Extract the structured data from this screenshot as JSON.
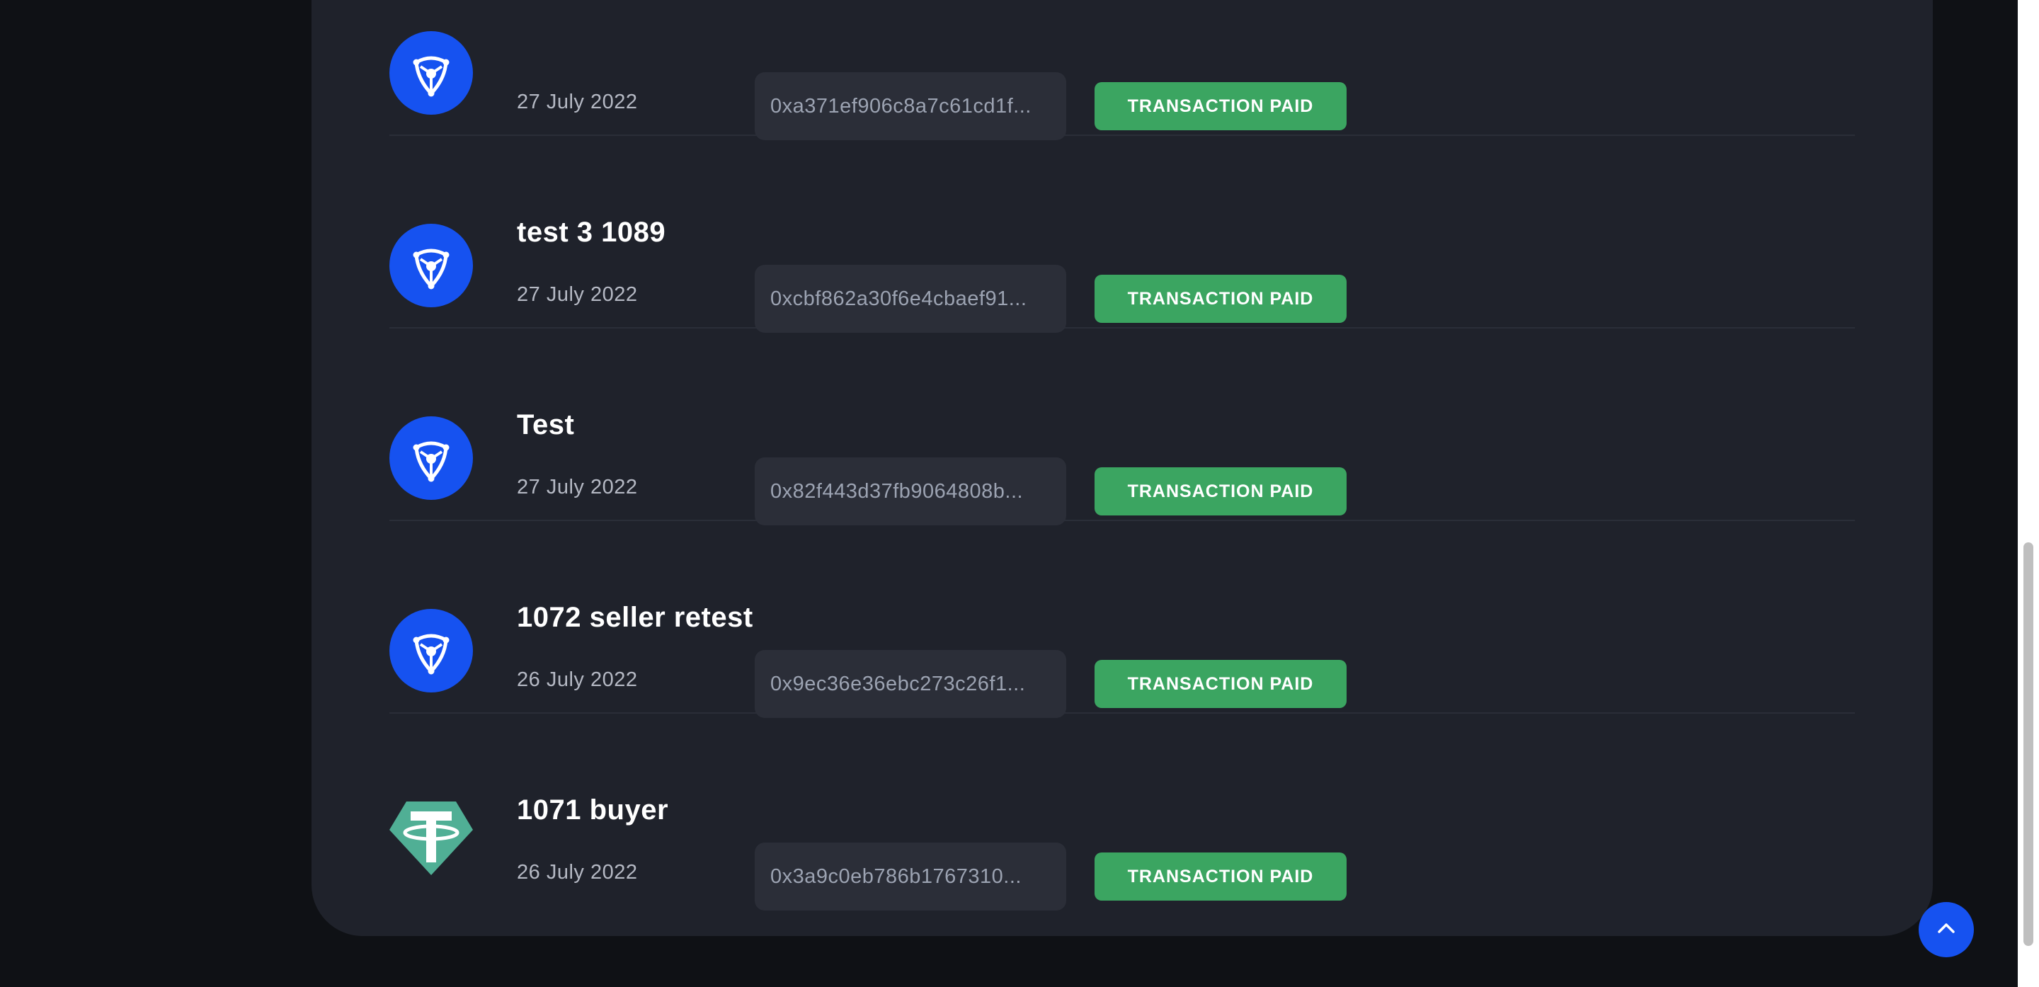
{
  "transactions": [
    {
      "title": "",
      "date": "27 July 2022",
      "hash": "0xa371ef906c8a7c61cd1f...",
      "status": "TRANSACTION PAID",
      "token_icon": "hapi-token-icon"
    },
    {
      "title": "test 3 1089",
      "date": "27 July 2022",
      "hash": "0xcbf862a30f6e4cbaef91...",
      "status": "TRANSACTION PAID",
      "token_icon": "hapi-token-icon"
    },
    {
      "title": "Test",
      "date": "27 July 2022",
      "hash": "0x82f443d37fb9064808b...",
      "status": "TRANSACTION PAID",
      "token_icon": "hapi-token-icon"
    },
    {
      "title": "1072 seller retest",
      "date": "26 July 2022",
      "hash": "0x9ec36e36ebc273c26f1...",
      "status": "TRANSACTION PAID",
      "token_icon": "hapi-token-icon"
    },
    {
      "title": "1071 buyer",
      "date": "26 July 2022",
      "hash": "0x3a9c0eb786b1767310...",
      "status": "TRANSACTION PAID",
      "token_icon": "tether-usdt-icon"
    }
  ],
  "colors": {
    "page_background": "#0f1115",
    "card_background": "#1f222b",
    "hash_background": "#2b2e38",
    "status_paid": "#3ba561",
    "accent_blue": "#1652f0",
    "tether_green": "#50af95"
  },
  "scroll_top_button": {
    "icon": "chevron-up-icon"
  }
}
